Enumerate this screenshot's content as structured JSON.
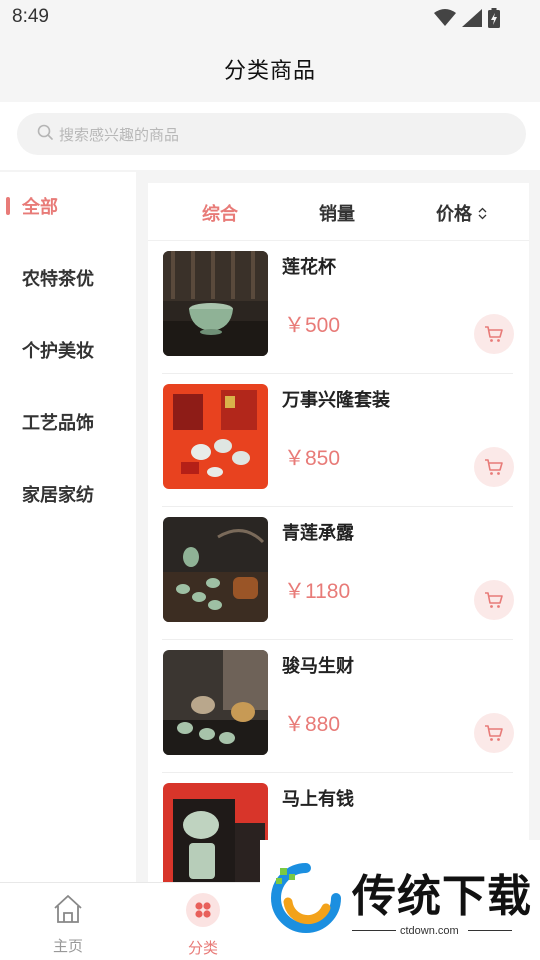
{
  "status_bar": {
    "time": "8:49"
  },
  "header": {
    "title": "分类商品"
  },
  "search": {
    "placeholder": "搜索感兴趣的商品"
  },
  "sidebar": {
    "items": [
      {
        "label": "全部",
        "active": true
      },
      {
        "label": "农特茶优",
        "active": false
      },
      {
        "label": "个护美妆",
        "active": false
      },
      {
        "label": "工艺品饰",
        "active": false
      },
      {
        "label": "家居家纺",
        "active": false
      }
    ]
  },
  "sort_tabs": [
    {
      "label": "综合",
      "active": true
    },
    {
      "label": "销量",
      "active": false
    },
    {
      "label": "价格",
      "active": false
    }
  ],
  "products": [
    {
      "name": "莲花杯",
      "price": "￥500"
    },
    {
      "name": "万事兴隆套装",
      "price": "￥850"
    },
    {
      "name": "青莲承露",
      "price": "￥1180"
    },
    {
      "name": "骏马生财",
      "price": "￥880"
    },
    {
      "name": "马上有钱",
      "price": ""
    }
  ],
  "bottom_nav": [
    {
      "label": "主页",
      "icon": "home-icon",
      "active": false
    },
    {
      "label": "分类",
      "icon": "category-icon",
      "active": true
    }
  ],
  "watermark": {
    "title": "传统下载",
    "url": "ctdown.com"
  },
  "colors": {
    "accent": "#e87b78",
    "accent_light": "#fbe9e8",
    "background": "#f4f4f4"
  }
}
